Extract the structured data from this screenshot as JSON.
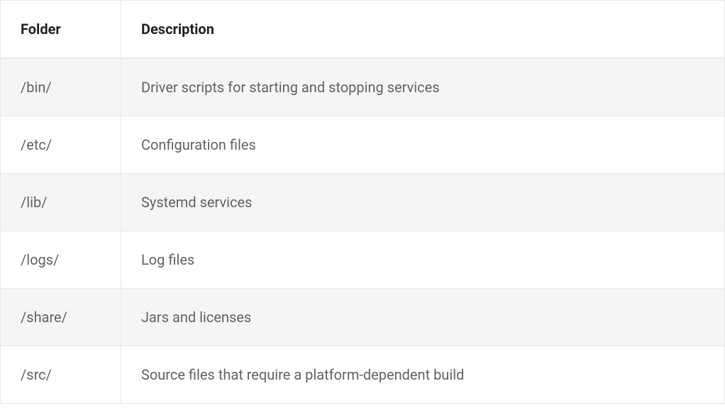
{
  "table": {
    "headers": {
      "folder": "Folder",
      "description": "Description"
    },
    "rows": [
      {
        "folder": "/bin/",
        "description": "Driver scripts for starting and stopping services"
      },
      {
        "folder": "/etc/",
        "description": "Configuration files"
      },
      {
        "folder": "/lib/",
        "description": "Systemd services"
      },
      {
        "folder": "/logs/",
        "description": "Log files"
      },
      {
        "folder": "/share/",
        "description": "Jars and licenses"
      },
      {
        "folder": "/src/",
        "description": "Source files that require a platform-dependent build"
      }
    ]
  }
}
